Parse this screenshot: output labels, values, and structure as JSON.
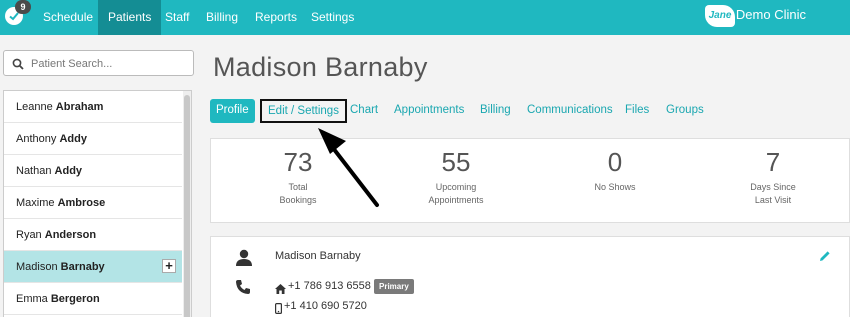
{
  "nav": {
    "notification_count": "9",
    "items": [
      "Schedule",
      "Patients",
      "Staff",
      "Billing",
      "Reports",
      "Settings"
    ],
    "active": "Patients",
    "brand_mark": "Jane",
    "clinic_name": "Demo Clinic"
  },
  "search": {
    "placeholder": "Patient Search..."
  },
  "patients": [
    {
      "first": "Leanne",
      "last": "Abraham"
    },
    {
      "first": "Anthony",
      "last": "Addy"
    },
    {
      "first": "Nathan",
      "last": "Addy"
    },
    {
      "first": "Maxime",
      "last": "Ambrose"
    },
    {
      "first": "Ryan",
      "last": "Anderson"
    },
    {
      "first": "Madison",
      "last": "Barnaby"
    },
    {
      "first": "Emma",
      "last": "Bergeron"
    }
  ],
  "selected_patient_plus": "+",
  "main": {
    "title": "Madison Barnaby",
    "tabs": [
      "Profile",
      "Edit / Settings",
      "Chart",
      "Appointments",
      "Billing",
      "Communications",
      "Files",
      "Groups"
    ],
    "active_tab": "Profile"
  },
  "stats": [
    {
      "value": "73",
      "label_line1": "Total",
      "label_line2": "Bookings"
    },
    {
      "value": "55",
      "label_line1": "Upcoming",
      "label_line2": "Appointments"
    },
    {
      "value": "0",
      "label_line1": "No Shows",
      "label_line2": ""
    },
    {
      "value": "7",
      "label_line1": "Days Since",
      "label_line2": "Last Visit"
    }
  ],
  "contact": {
    "name": "Madison Barnaby",
    "phone_home": "+1 786 913 6558",
    "phone_home_badge": "Primary",
    "phone_mobile": "+1 410 690 5720"
  },
  "colors": {
    "accent": "#1fb8c0",
    "nav_active": "#148d94",
    "selected_row": "#b3e4e6"
  }
}
